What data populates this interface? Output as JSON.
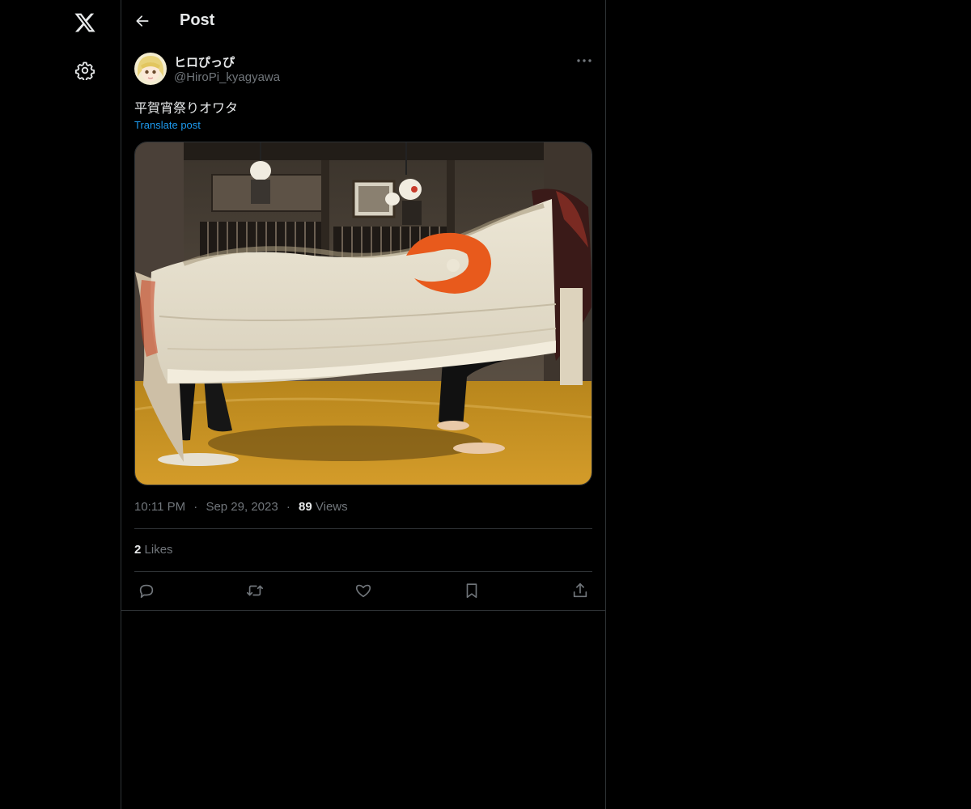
{
  "header": {
    "title": "Post"
  },
  "author": {
    "display_name": "ヒロぴっぴ",
    "handle": "@HiroPi_kyagyawa"
  },
  "post": {
    "text": "平賀宵祭りオワタ",
    "translate_label": "Translate post"
  },
  "meta": {
    "time": "10:11 PM",
    "separator": "·",
    "date": "Sep 29, 2023",
    "views_count": "89",
    "views_label": "Views"
  },
  "stats": {
    "likes_count": "2",
    "likes_label": "Likes"
  },
  "icons": {
    "logo": "x-logo-icon",
    "settings": "gear-icon",
    "back": "arrow-left-icon",
    "more": "more-horizontal-icon",
    "reply": "reply-icon",
    "repost": "repost-icon",
    "like": "heart-icon",
    "bookmark": "bookmark-icon",
    "share": "share-icon"
  },
  "colors": {
    "background": "#000000",
    "text_primary": "#e7e9ea",
    "text_secondary": "#71767b",
    "link": "#1d9bf0",
    "border": "#2f3336"
  }
}
